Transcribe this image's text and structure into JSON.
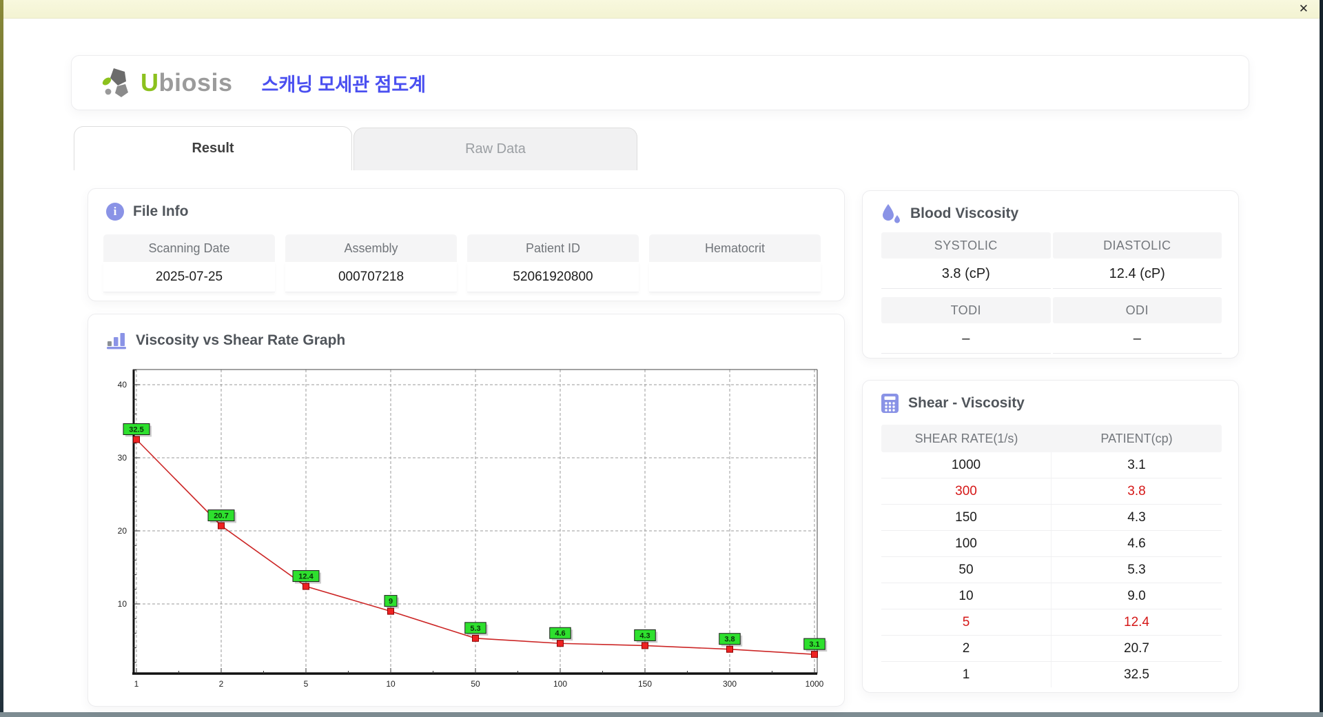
{
  "window": {
    "close_glyph": "✕"
  },
  "header": {
    "brand_u": "U",
    "brand_rest": "biosis",
    "title_korean": "스캐닝 모세관 점도계"
  },
  "tabs": [
    {
      "label": "Result",
      "active": true
    },
    {
      "label": "Raw Data",
      "active": false
    }
  ],
  "file_info": {
    "title": "File Info",
    "fields": [
      {
        "label": "Scanning Date",
        "value": "2025-07-25"
      },
      {
        "label": "Assembly",
        "value": "000707218"
      },
      {
        "label": "Patient ID",
        "value": "52061920800"
      },
      {
        "label": "Hematocrit",
        "value": ""
      }
    ]
  },
  "blood_viscosity": {
    "title": "Blood Viscosity",
    "rows": [
      {
        "labels": [
          "SYSTOLIC",
          "DIASTOLIC"
        ],
        "values": [
          "3.8 (cP)",
          "12.4 (cP)"
        ]
      },
      {
        "labels": [
          "TODI",
          "ODI"
        ],
        "values": [
          "–",
          "–"
        ]
      }
    ]
  },
  "graph": {
    "title": "Viscosity vs Shear Rate Graph"
  },
  "chart_data": {
    "type": "line",
    "title": "Viscosity vs Shear Rate Graph",
    "xlabel": "",
    "ylabel": "",
    "x_scale": "categorical",
    "categories": [
      1,
      2,
      5,
      10,
      50,
      100,
      150,
      300,
      1000
    ],
    "series": [
      {
        "name": "PATIENT",
        "values": [
          32.5,
          20.7,
          12.4,
          9,
          5.3,
          4.6,
          4.3,
          3.8,
          3.1
        ]
      }
    ],
    "point_labels": [
      "32.5",
      "20.7",
      "12.4",
      "9",
      "5.3",
      "4.6",
      "4.3",
      "3.8",
      "3.1"
    ],
    "ylim": [
      0,
      42
    ],
    "yticks": [
      10,
      20,
      30,
      40
    ],
    "grid": true,
    "legend": false
  },
  "shear_table": {
    "title": "Shear - Viscosity",
    "columns": [
      "SHEAR RATE(1/s)",
      "PATIENT(cp)"
    ],
    "rows": [
      {
        "shear": "1000",
        "patient": "3.1",
        "highlight": false
      },
      {
        "shear": "300",
        "patient": "3.8",
        "highlight": true
      },
      {
        "shear": "150",
        "patient": "4.3",
        "highlight": false
      },
      {
        "shear": "100",
        "patient": "4.6",
        "highlight": false
      },
      {
        "shear": "50",
        "patient": "5.3",
        "highlight": false
      },
      {
        "shear": "10",
        "patient": "9.0",
        "highlight": false
      },
      {
        "shear": "5",
        "patient": "12.4",
        "highlight": true
      },
      {
        "shear": "2",
        "patient": "20.7",
        "highlight": false
      },
      {
        "shear": "1",
        "patient": "32.5",
        "highlight": false
      }
    ]
  },
  "colors": {
    "accent_purple": "#8a93e6",
    "title_blue": "#4a4ff0",
    "brand_green": "#8cc11e",
    "brand_gray": "#9b9b9b",
    "highlight_red": "#d51717",
    "chart_line": "#cc2626",
    "marker_fill": "#ee2222",
    "marker_border": "#8b0000",
    "label_green": "#2ee02e",
    "titlebar_yellow": "#f6f6d8"
  }
}
